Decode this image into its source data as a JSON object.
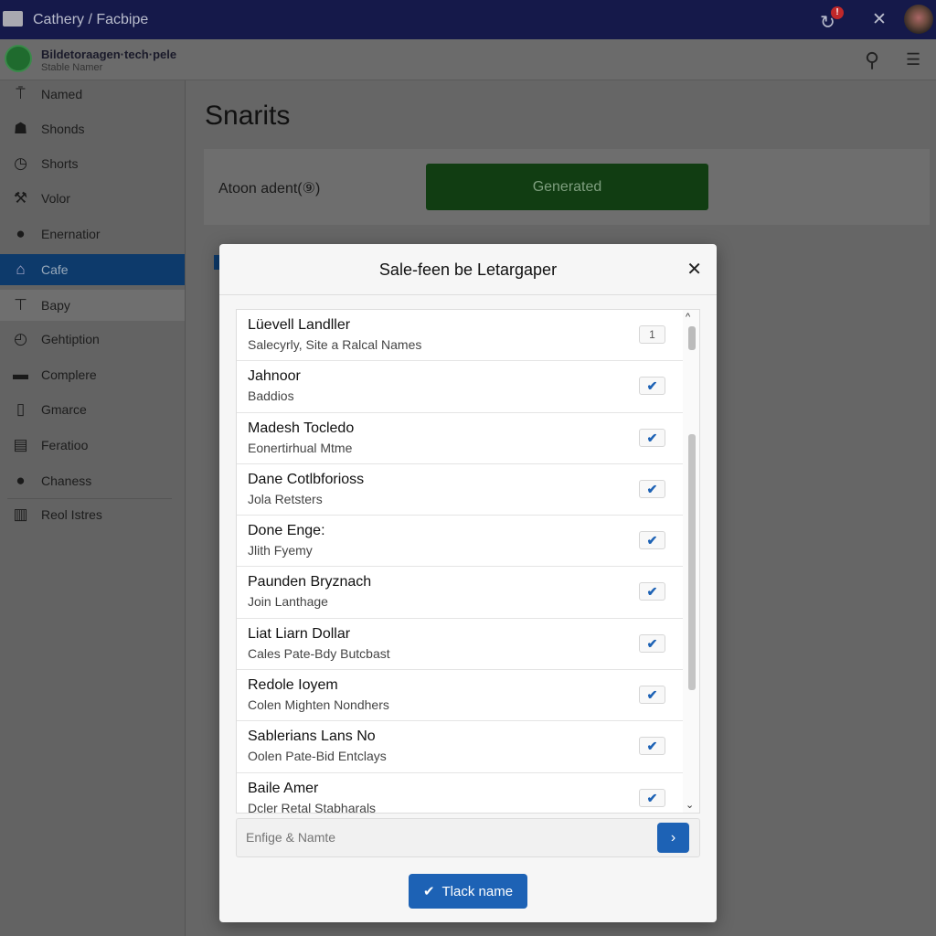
{
  "topbar": {
    "breadcrumb": "Cathery / Facbipe",
    "notification_count": "!"
  },
  "org": {
    "name": "Bildetoraagen·tech·pele",
    "subtitle": "Stable Namer"
  },
  "sidebar": {
    "items": [
      {
        "label": "Named",
        "icon": "antenna-icon"
      },
      {
        "label": "Shonds",
        "icon": "group-icon"
      },
      {
        "label": "Shorts",
        "icon": "clock-icon"
      },
      {
        "label": "Volor",
        "icon": "tool-icon"
      },
      {
        "label": "Enernatior",
        "icon": "info-icon"
      },
      {
        "label": "Cafe",
        "icon": "home-icon",
        "active": true
      },
      {
        "label": "Bapy",
        "icon": "tray-icon"
      },
      {
        "label": "Gehtiption",
        "icon": "timer-icon"
      },
      {
        "label": "Complere",
        "icon": "terminal-icon"
      },
      {
        "label": "Gmarce",
        "icon": "document-icon"
      },
      {
        "label": "Feratioo",
        "icon": "card-icon"
      },
      {
        "label": "Chaness",
        "icon": "weight-icon"
      },
      {
        "label": "Reol Istres",
        "icon": "building-icon"
      }
    ]
  },
  "main": {
    "title": "Snarits",
    "action_label": "Atoon adent(⑨)",
    "generated_label": "Generated",
    "accent": "#113d12"
  },
  "modal": {
    "title": "Sale-feen be Letargaper",
    "items": [
      {
        "name": "Lüevell Landller",
        "sub": "Salecyrly, Site a Ralcal Names",
        "mark": "1"
      },
      {
        "name": "Jahnoor",
        "sub": "Baddios",
        "mark": "✔"
      },
      {
        "name": "Madesh Tocledo",
        "sub": "Eonertirhual Mtme",
        "mark": "✔"
      },
      {
        "name": "Dane Cotlbforioss",
        "sub": "Jola Retsters",
        "mark": "✔"
      },
      {
        "name": "Done Enge:",
        "sub": "Jlith Fyemy",
        "mark": "✔"
      },
      {
        "name": "Paunden Bryznach",
        "sub": "Join Lanthage",
        "mark": "✔"
      },
      {
        "name": "Liat Liarn Dollar",
        "sub": "Cales Pate-Bdy Butcbast",
        "mark": "✔"
      },
      {
        "name": "Redole Ioyem",
        "sub": "Colen Mighten Nondhers",
        "mark": "✔"
      },
      {
        "name": "Sablerians Lans No",
        "sub": "Oolen Pate-Bid Entclays",
        "mark": "✔"
      },
      {
        "name": "Baile Amer",
        "sub": "Dcler Retal Stabharals",
        "mark": "✔"
      }
    ],
    "input_placeholder": "Enfige & Namte",
    "confirm_label": "Tlack name",
    "primary_color": "#1d62b5"
  }
}
